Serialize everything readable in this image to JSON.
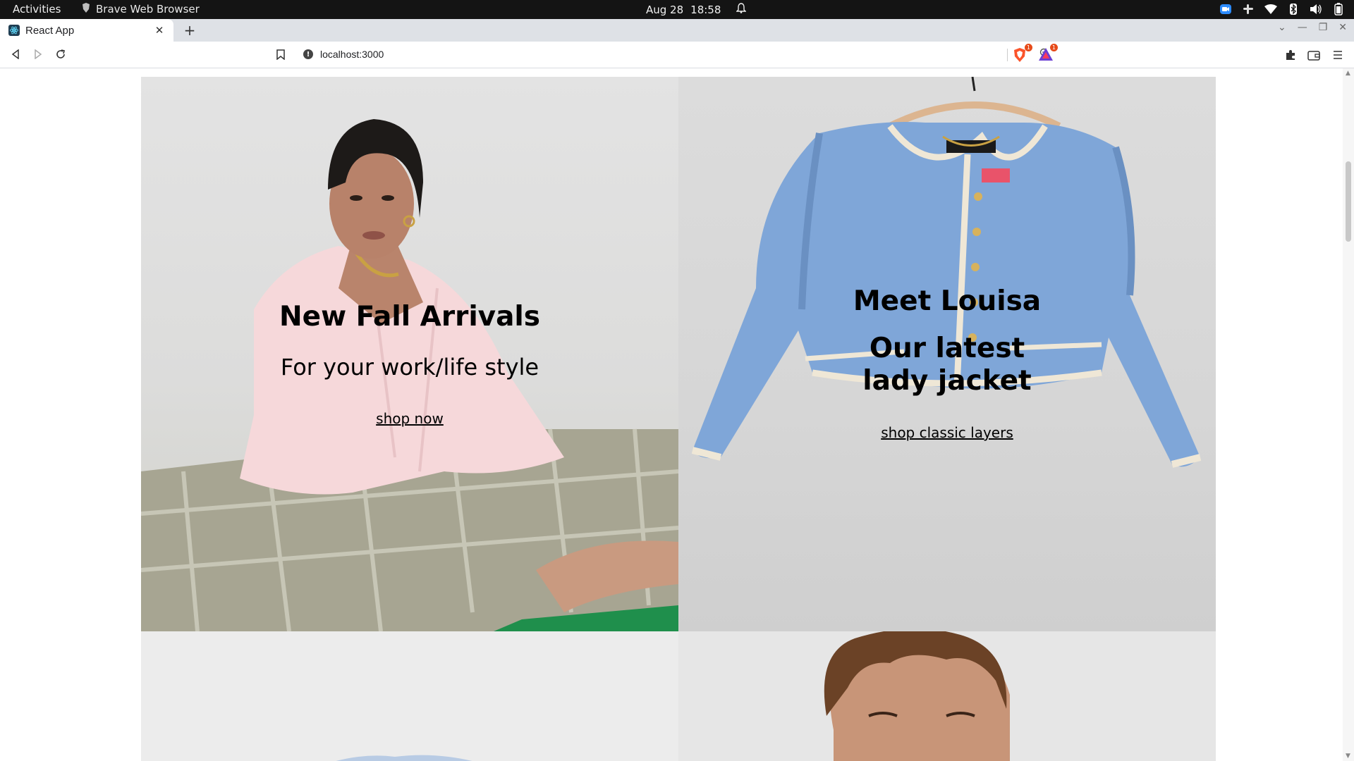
{
  "system": {
    "activities": "Activities",
    "app_indicator": "Brave Web Browser",
    "date": "Aug 28",
    "time": "18:58"
  },
  "browser": {
    "tab_title": "React App",
    "url": "localhost:3000",
    "shields_badge": "1",
    "rewards_badge": "1"
  },
  "page": {
    "fall": {
      "heading": "New Fall Arrivals",
      "subheading": "For your work/life style",
      "link": "shop now"
    },
    "louisa": {
      "heading": "Meet Louisa",
      "subheading": "Our latest lady jacket",
      "link": "shop classic layers"
    }
  }
}
